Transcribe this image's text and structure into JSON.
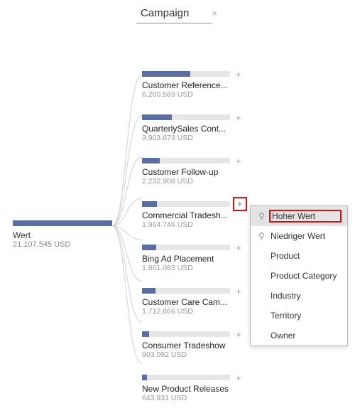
{
  "header": {
    "title": "Campaign",
    "close_glyph": "×"
  },
  "root": {
    "label": "Wert",
    "value": "21.107.545 USD"
  },
  "nodes": [
    {
      "label": "Customer Reference...",
      "value": "6.260.569 USD",
      "fill_pct": 55,
      "highlight": false
    },
    {
      "label": "QuarterlySales Cont...",
      "value": "3.903.673 USD",
      "fill_pct": 34,
      "highlight": false
    },
    {
      "label": "Customer Follow-up",
      "value": "2.232.908 USD",
      "fill_pct": 20,
      "highlight": false
    },
    {
      "label": "Commercial Tradesh...",
      "value": "1.964.746 USD",
      "fill_pct": 17,
      "highlight": true
    },
    {
      "label": "Bing Ad Placement",
      "value": "1.861.083 USD",
      "fill_pct": 16,
      "highlight": false
    },
    {
      "label": "Customer Care Cam...",
      "value": "1.712.866 USD",
      "fill_pct": 15,
      "highlight": false
    },
    {
      "label": "Consumer Tradeshow",
      "value": "903.092 USD",
      "fill_pct": 8,
      "highlight": false
    },
    {
      "label": "New Product Releases",
      "value": "643.931 USD",
      "fill_pct": 6,
      "highlight": false
    }
  ],
  "menu": {
    "items": [
      {
        "label": "Hoher Wert",
        "bulb": true,
        "selected": true
      },
      {
        "label": "Niedriger Wert",
        "bulb": true,
        "selected": false
      },
      {
        "label": "Product",
        "bulb": false,
        "selected": false
      },
      {
        "label": "Product Category",
        "bulb": false,
        "selected": false
      },
      {
        "label": "Industry",
        "bulb": false,
        "selected": false
      },
      {
        "label": "Territory",
        "bulb": false,
        "selected": false
      },
      {
        "label": "Owner",
        "bulb": false,
        "selected": false
      }
    ]
  },
  "expand_glyph": "+",
  "colors": {
    "bar_fill": "#5B6EA3",
    "highlight": "#d11"
  },
  "chart_data": {
    "type": "bar",
    "title": "Campaign",
    "total_label": "Wert",
    "total_value": 21107545,
    "currency": "USD",
    "categories": [
      "Customer Reference...",
      "QuarterlySales Cont...",
      "Customer Follow-up",
      "Commercial Tradesh...",
      "Bing Ad Placement",
      "Customer Care Cam...",
      "Consumer Tradeshow",
      "New Product Releases"
    ],
    "values": [
      6260569,
      3903673,
      2232908,
      1964746,
      1861083,
      1712866,
      903092,
      643931
    ]
  }
}
